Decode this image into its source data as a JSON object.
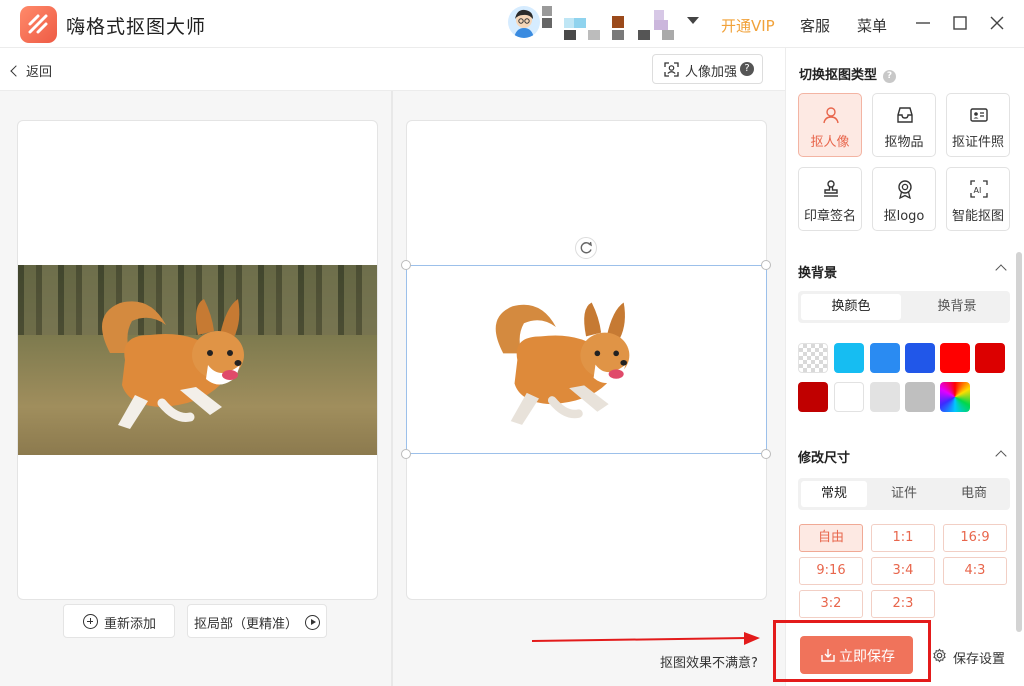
{
  "app": {
    "title": "嗨格式抠图大师"
  },
  "header": {
    "vip": "开通VIP",
    "service": "客服",
    "menu": "菜单"
  },
  "toolbar": {
    "back": "返回",
    "portrait_enhance": "人像加强",
    "help_mark": "?"
  },
  "left_actions": {
    "readd": "重新添加",
    "local_cutout": "抠局部（更精准）"
  },
  "footer": {
    "unsatisfied": "抠图效果不满意?",
    "save_now": "立即保存",
    "save_settings": "保存设置"
  },
  "sidebar": {
    "switch_title": "切换抠图类型",
    "help_mark": "?",
    "types": [
      {
        "label": "抠人像",
        "icon": "person-icon",
        "active": true
      },
      {
        "label": "抠物品",
        "icon": "inbox-icon",
        "active": false
      },
      {
        "label": "抠证件照",
        "icon": "id-card-icon",
        "active": false
      },
      {
        "label": "印章签名",
        "icon": "stamp-icon",
        "active": false
      },
      {
        "label": "抠logo",
        "icon": "badge-icon",
        "active": false
      },
      {
        "label": "智能抠图",
        "icon": "ai-icon",
        "active": false
      }
    ],
    "bg_section": {
      "title": "换背景",
      "tabs": [
        "换颜色",
        "换背景"
      ],
      "active_tab": 0,
      "colors": [
        "transparent",
        "#16bdf2",
        "#2a8bf2",
        "#2157e9",
        "#ff0000",
        "#dc0000",
        "#c00000",
        "#ffffff",
        "#e2e2e2",
        "#bfbfbf",
        "rainbow"
      ]
    },
    "size_section": {
      "title": "修改尺寸",
      "tabs": [
        "常规",
        "证件",
        "电商"
      ],
      "active_tab": 0,
      "ratios": [
        "自由",
        "1:1",
        "16:9",
        "9:16",
        "3:4",
        "4:3",
        "3:2",
        "2:3"
      ],
      "active_ratio": 0
    }
  }
}
